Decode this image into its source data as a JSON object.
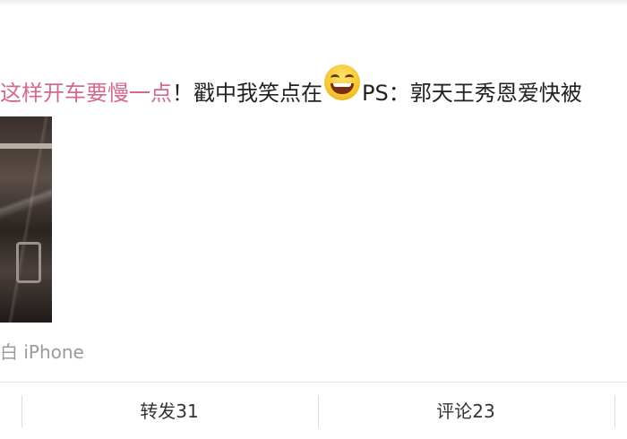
{
  "post": {
    "text_highlight": "这样开车要慢一点",
    "text_after_highlight": "！戳中我笑点在",
    "emoji_icon": "laughing-face-icon",
    "text_after_emoji": "PS：郭天王秀恩爱快被"
  },
  "source": {
    "label": "白 iPhone"
  },
  "actions": {
    "repost_label": "转发31",
    "comment_label": "评论23"
  },
  "colors": {
    "highlight_text": "#d46a8a",
    "body_text": "#222222",
    "meta_text": "#9a9a9a"
  }
}
